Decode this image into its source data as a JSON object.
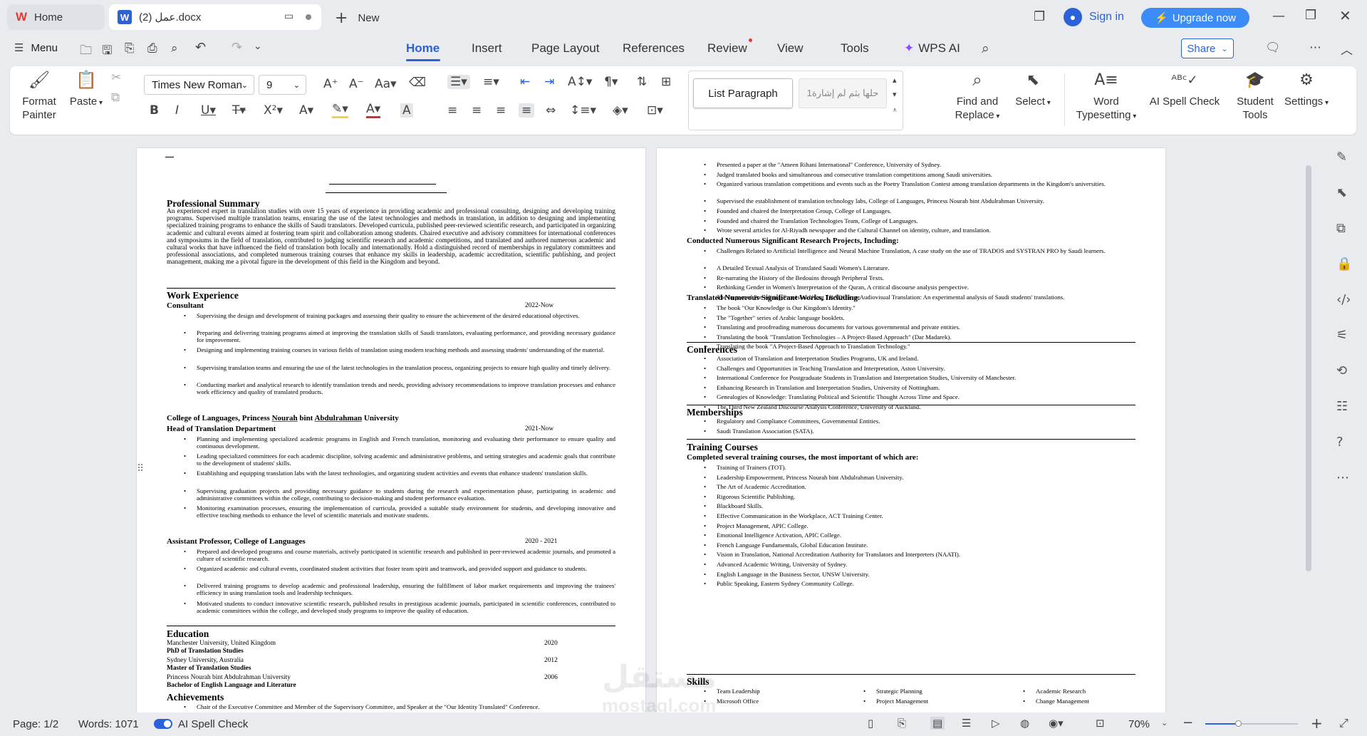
{
  "tabs": {
    "home": "Home",
    "doc": "عمل (2).docx",
    "new": "New"
  },
  "account": {
    "sign_in": "Sign in",
    "upgrade": "Upgrade now"
  },
  "menu": {
    "menu_label": "Menu",
    "tabs": [
      "Home",
      "Insert",
      "Page Layout",
      "References",
      "Review",
      "View",
      "Tools",
      "WPS AI"
    ],
    "share": "Share"
  },
  "ribbon": {
    "format_painter": [
      "Format",
      "Painter"
    ],
    "paste": "Paste",
    "font_name": "Times New Roman",
    "font_size": "9",
    "style1": "List Paragraph",
    "style2": "1حلها بثم لم إشارة",
    "find_replace": [
      "Find and",
      "Replace"
    ],
    "select": "Select",
    "word_typesetting": [
      "Word",
      "Typesetting"
    ],
    "ai_spell": "AI Spell Check",
    "student_tools": [
      "Student",
      "Tools"
    ],
    "settings": "Settings"
  },
  "colors": {
    "accent": "#2b62d9",
    "upgrade": "#3b8cf7",
    "highlight": "#f6d23c",
    "font_color": "#d32f2f"
  },
  "page1": {
    "summary_title": "Professional Summary",
    "summary": "An experienced expert in translation studies with over 15 years of experience in providing academic and professional consulting, designing and developing training programs. Supervised multiple translation teams, ensuring the use of the latest technologies and methods in translation, in addition to designing and implementing specialized training programs to enhance the skills of Saudi translators. Developed curricula, published peer-reviewed scientific research, and participated in organizing academic and cultural events aimed at fostering team spirit and collaboration among students. Chaired executive and advisory committees for international conferences and symposiums in the field of translation, contributed to judging scientific research and academic competitions, and translated and authored numerous academic and cultural works that have influenced the field of translation both locally and internationally. Hold a distinguished record of memberships in regulatory committees and professional associations, and completed numerous training courses that enhance my skills in leadership, academic accreditation, scientific publishing, and project management, making me a pivotal figure in the development of this field in the Kingdom and beyond.",
    "work_title": "Work Experience",
    "consultant": "Consultant",
    "consultant_date": "2022-Now",
    "consultant_items": [
      "Supervising the design and development of training packages and assessing their quality to ensure the achievement of the desired educational objectives.",
      "Preparing and delivering training programs aimed at improving the translation skills of Saudi translators, evaluating performance, and providing necessary guidance for improvement.",
      "Designing and implementing training courses in various fields of translation using modern teaching methods and assessing students' understanding of the material.",
      "Supervising translation teams and ensuring the use of the latest technologies in the translation process, organizing projects to ensure high quality and timely delivery.",
      "Conducting market and analytical research to identify translation trends and needs, providing advisory recommendations to improve translation processes and enhance work efficiency and quality of translated products."
    ],
    "college": "College of Languages, Princess Nourah bint Abdulrahman University",
    "hod": "Head of Translation Department",
    "hod_date": "2021-Now",
    "hod_items": [
      "Planning and implementing specialized academic programs in English and French translation, monitoring and evaluating their performance to ensure quality and continuous development.",
      "Leading specialized committees for each academic discipline, solving academic and administrative problems, and setting strategies and academic goals that contribute to the development of students' skills.",
      "Establishing and equipping translation labs with the latest technologies, and organizing student activities and events that enhance students' translation skills.",
      "Supervising graduation projects and providing necessary guidance to students during the research and experimentation phase, participating in academic and administrative committees within the college, contributing to decision-making and student performance evaluation.",
      "Monitoring examination processes, ensuring the implementation of curricula, provided a suitable study environment for students, and developing innovative and effective teaching methods to enhance the level of scientific materials and motivate students."
    ],
    "ap": "Assistant Professor, College of Languages",
    "ap_date": "2020 - 2021",
    "ap_items": [
      "Prepared and developed programs and course materials, actively participated in scientific research and published in peer-reviewed academic journals, and promoted a culture of scientific research.",
      "Organized academic and cultural events, coordinated student activities that foster team spirit and teamwork, and provided support and guidance to students.",
      "Delivered training programs to develop academic and professional leadership, ensuring the fulfillment of labor market requirements and improving the trainees' efficiency in using translation tools and leadership techniques.",
      "Motivated students to conduct innovative scientific research, published results in prestigious academic journals, participated in scientific conferences, contributed to academic committees within the college, and developed study programs to improve the quality of education."
    ],
    "edu_title": "Education",
    "edu": [
      {
        "school": "Manchester University, United Kingdom",
        "year": "2020",
        "degree": "PhD of Translation Studies"
      },
      {
        "school": "Sydney University, Australia",
        "year": "2012",
        "degree": "Master of Translation Studies"
      },
      {
        "school": "Princess Nourah bint Abdulrahman University",
        "year": "2006",
        "degree": "Bachelor of English Language and Literature"
      }
    ],
    "ach_title": "Achievements",
    "ach_first": "Chair of the Executive Committee and Member of the Supervisory Committee, and Speaker at the \"Our Identity Translated\" Conference."
  },
  "page2": {
    "top_items": [
      "Presented a paper at the \"Ameen Rihani International\" Conference, University of Sydney.",
      "Judged translated books and simultaneous and consecutive translation competitions among Saudi universities.",
      "Organized various translation competitions and events such as the Poetry Translation Contest among translation departments in the Kingdom's universities.",
      "Supervised the establishment of translation technology labs, College of Languages, Princess Nourah bint Abdulrahman University.",
      "Founded and chaired the Interpretation Group, College of Languages.",
      "Founded and chaired the Translation Technologies Team, College of Languages.",
      "Wrote several articles for Al-Riyadh newspaper and the Cultural Channel on identity, culture, and translation."
    ],
    "research_title": "Conducted Numerous Significant Research Projects, Including:",
    "research_items": [
      "Challenges Related to Artificial Intelligence and Neural Machine Translation, A case study on the use of TRADOS and SYSTRAN PRO by Saudi learners.",
      "A Detailed Textual Analysis of Translated Saudi Women's Literature.",
      "Re-narrating the History of the Bedouins through Peripheral Texts.",
      "Rethinking Gender in Women's Interpretation of the Quran, A critical discourse analysis perspective.",
      "The Impact of Pre-editing Processes Using TRADOS on Audiovisual Translation: An experimental analysis of Saudi students' translations."
    ],
    "translated_title": "Translated Numerous Significant Works, Including:",
    "translated_items": [
      "The book \"Our Knowledge is Our Kingdom's Identity.\"",
      "The \"Together\" series of Arabic language booklets.",
      "Translating and proofreading numerous documents for various governmental and private entities.",
      "Translating the book \"Translation Technologies – A Project-Based Approach\" (Dar Madarek).",
      "Translating the book \"A Project-Based Approach to Translation Technology.\""
    ],
    "conf_title": "Conferences",
    "conf_items": [
      "Association of Translation and Interpretation Studies Programs, UK and Ireland.",
      "Challenges and Opportunities in Teaching Translation and Interpretation, Aston University.",
      "International Conference for Postgraduate Students in Translation and Interpretation Studies, University of Manchester.",
      "Enhancing Research in Translation and Interpretation Studies, University of Nottingham.",
      "Genealogies of Knowledge: Translating Political and Scientific Thought Across Time and Space.",
      "The Third New Zealand Discourse Analysis Conference, University of Auckland."
    ],
    "mem_title": "Memberships",
    "mem_items": [
      "Regulatory and Compliance Committees, Governmental Entities.",
      "Saudi Translation Association (SATA)."
    ],
    "train_title": "Training Courses",
    "train_sub": "Completed several training courses, the most important of which are:",
    "train_items": [
      "Training of Trainers (TOT).",
      "Leadership Empowerment, Princess Nourah bint Abdulrahman University.",
      "The Art of Academic Accreditation.",
      "Rigorous Scientific Publishing.",
      "Blackboard Skills.",
      "Effective Communication in the Workplace, ACT Training Center.",
      "Project Management, APIC College.",
      "Emotional Intelligence Activation, APIC College.",
      "French Language Fundamentals, Global Education Institute.",
      "Vision in Translation, National Accreditation Authority for Translators and Interpreters (NAATI).",
      "Advanced Academic Writing, University of Sydney.",
      "English Language in the Business Sector, UNSW University.",
      "Public Speaking, Eastern Sydney Community College."
    ],
    "skills_title": "Skills",
    "skills": [
      [
        "Team Leadership",
        "Microsoft Office"
      ],
      [
        "Strategic Planning",
        "Project Management"
      ],
      [
        "Academic Research",
        "Change Management"
      ]
    ]
  },
  "status": {
    "page": "Page: 1/2",
    "words": "Words: 1071",
    "ai_spell": "AI Spell Check",
    "zoom": "70%"
  },
  "watermark": {
    "ar": "مستقل",
    "en": "mostaql.com"
  }
}
